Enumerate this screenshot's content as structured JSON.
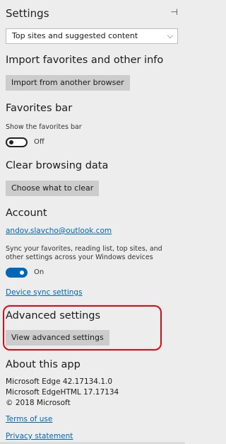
{
  "header": {
    "title": "Settings",
    "pin_glyph": "⊣"
  },
  "open_with": {
    "value": "Top sites and suggested content",
    "chevron": "⌵"
  },
  "import": {
    "heading": "Import favorites and other info",
    "button": "Import from another browser"
  },
  "favorites_bar": {
    "heading": "Favorites bar",
    "label": "Show the favorites bar",
    "state": "Off"
  },
  "clear": {
    "heading": "Clear browsing data",
    "button": "Choose what to clear"
  },
  "account": {
    "heading": "Account",
    "email": "andov.slavcho@outlook.com",
    "sync_text": "Sync your favorites, reading list, top sites, and other settings across your Windows devices",
    "sync_state": "On",
    "device_sync_link": "Device sync settings"
  },
  "advanced": {
    "heading": "Advanced settings",
    "button": "View advanced settings",
    "highlight_color": "#e10a14"
  },
  "about": {
    "heading": "About this app",
    "edge_version": "Microsoft Edge 42.17134.1.0",
    "html_version": "Microsoft EdgeHTML 17.17134",
    "copyright": "© 2018 Microsoft",
    "terms_link": "Terms of use",
    "privacy_link": "Privacy statement"
  },
  "colors": {
    "accent": "#0067b8",
    "background": "#ededed",
    "button": "#cccccc"
  }
}
